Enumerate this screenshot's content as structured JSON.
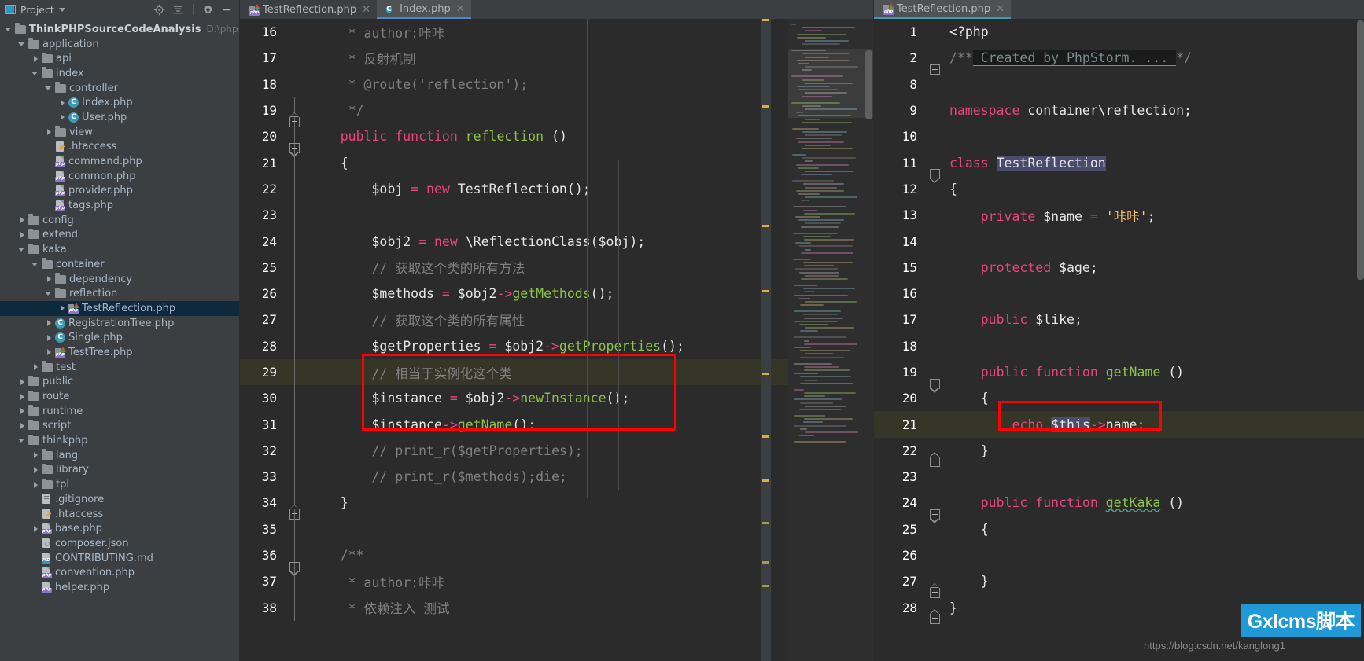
{
  "window": {
    "app": "PhpStorm"
  },
  "project_panel": {
    "title": "Project",
    "icons": [
      "locate-icon",
      "collapse-all-icon",
      "gear-icon",
      "minimize-icon"
    ],
    "tree": [
      {
        "label": "ThinkPHPSourceCodeAnalysis",
        "path": "D:\\phpstudy_pro\\W",
        "depth": 0,
        "arrow": "down",
        "icon": "folder",
        "bold": true
      },
      {
        "label": "application",
        "depth": 1,
        "arrow": "down",
        "icon": "folder"
      },
      {
        "label": "api",
        "depth": 2,
        "arrow": "right",
        "icon": "folder"
      },
      {
        "label": "index",
        "depth": 2,
        "arrow": "down",
        "icon": "folder"
      },
      {
        "label": "controller",
        "depth": 3,
        "arrow": "down",
        "icon": "folder"
      },
      {
        "label": "Index.php",
        "depth": 4,
        "arrow": "right",
        "icon": "php-class"
      },
      {
        "label": "User.php",
        "depth": 4,
        "arrow": "right",
        "icon": "php-class"
      },
      {
        "label": "view",
        "depth": 3,
        "arrow": "right",
        "icon": "folder"
      },
      {
        "label": ".htaccess",
        "depth": 3,
        "arrow": "none",
        "icon": "htaccess"
      },
      {
        "label": "command.php",
        "depth": 3,
        "arrow": "none",
        "icon": "php-file"
      },
      {
        "label": "common.php",
        "depth": 3,
        "arrow": "none",
        "icon": "php-file"
      },
      {
        "label": "provider.php",
        "depth": 3,
        "arrow": "none",
        "icon": "php-file"
      },
      {
        "label": "tags.php",
        "depth": 3,
        "arrow": "none",
        "icon": "php-file"
      },
      {
        "label": "config",
        "depth": 1,
        "arrow": "right",
        "icon": "folder"
      },
      {
        "label": "extend",
        "depth": 1,
        "arrow": "right",
        "icon": "folder"
      },
      {
        "label": "kaka",
        "depth": 1,
        "arrow": "down",
        "icon": "folder"
      },
      {
        "label": "container",
        "depth": 2,
        "arrow": "down",
        "icon": "folder"
      },
      {
        "label": "dependency",
        "depth": 3,
        "arrow": "right",
        "icon": "folder"
      },
      {
        "label": "reflection",
        "depth": 3,
        "arrow": "down",
        "icon": "folder"
      },
      {
        "label": "TestReflection.php",
        "depth": 4,
        "arrow": "right",
        "icon": "php-test",
        "selected": true
      },
      {
        "label": "RegistrationTree.php",
        "depth": 3,
        "arrow": "right",
        "icon": "php-class"
      },
      {
        "label": "Single.php",
        "depth": 3,
        "arrow": "right",
        "icon": "php-class"
      },
      {
        "label": "TestTree.php",
        "depth": 3,
        "arrow": "right",
        "icon": "php-test"
      },
      {
        "label": "test",
        "depth": 2,
        "arrow": "right",
        "icon": "folder"
      },
      {
        "label": "public",
        "depth": 1,
        "arrow": "right",
        "icon": "folder"
      },
      {
        "label": "route",
        "depth": 1,
        "arrow": "right",
        "icon": "folder"
      },
      {
        "label": "runtime",
        "depth": 1,
        "arrow": "right",
        "icon": "folder"
      },
      {
        "label": "script",
        "depth": 1,
        "arrow": "right",
        "icon": "folder"
      },
      {
        "label": "thinkphp",
        "depth": 1,
        "arrow": "down",
        "icon": "folder"
      },
      {
        "label": "lang",
        "depth": 2,
        "arrow": "right",
        "icon": "folder"
      },
      {
        "label": "library",
        "depth": 2,
        "arrow": "right",
        "icon": "folder"
      },
      {
        "label": "tpl",
        "depth": 2,
        "arrow": "right",
        "icon": "folder"
      },
      {
        "label": ".gitignore",
        "depth": 2,
        "arrow": "none",
        "icon": "gitignore"
      },
      {
        "label": ".htaccess",
        "depth": 2,
        "arrow": "none",
        "icon": "htaccess"
      },
      {
        "label": "base.php",
        "depth": 2,
        "arrow": "right",
        "icon": "php-file"
      },
      {
        "label": "composer.json",
        "depth": 2,
        "arrow": "none",
        "icon": "json"
      },
      {
        "label": "CONTRIBUTING.md",
        "depth": 2,
        "arrow": "none",
        "icon": "md-file"
      },
      {
        "label": "convention.php",
        "depth": 2,
        "arrow": "none",
        "icon": "php-file"
      },
      {
        "label": "helper.php",
        "depth": 2,
        "arrow": "none",
        "icon": "php-file"
      }
    ]
  },
  "left_tabs": [
    {
      "label": "TestReflection.php",
      "icon": "php-test",
      "active": false
    },
    {
      "label": "Index.php",
      "icon": "php-class",
      "active": true
    }
  ],
  "right_tabs": [
    {
      "label": "TestReflection.php",
      "icon": "php-test",
      "active": true
    }
  ],
  "browser_launcher": {
    "icons": [
      "chrome-icon",
      "edge-icon",
      "firefox-icon",
      "opera-icon",
      "safari-icon"
    ]
  },
  "left_editor": {
    "file": "Index.php",
    "first_line": 16,
    "highlighted_line": 29,
    "lines": [
      {
        "n": "16",
        "text": "     * author:咔咔"
      },
      {
        "n": "17",
        "text": "     * 反射机制"
      },
      {
        "n": "18",
        "text": "     * @route('reflection');"
      },
      {
        "n": "19",
        "text": "     */"
      },
      {
        "n": "20",
        "text": "    public function reflection ()"
      },
      {
        "n": "21",
        "text": "    {"
      },
      {
        "n": "22",
        "text": "        $obj = new TestReflection();"
      },
      {
        "n": "23",
        "text": ""
      },
      {
        "n": "24",
        "text": "        $obj2 = new \\ReflectionClass($obj);"
      },
      {
        "n": "25",
        "text": "        // 获取这个类的所有方法"
      },
      {
        "n": "26",
        "text": "        $methods = $obj2->getMethods();"
      },
      {
        "n": "27",
        "text": "        // 获取这个类的所有属性"
      },
      {
        "n": "28",
        "text": "        $getProperties = $obj2->getProperties();"
      },
      {
        "n": "29",
        "text": "        // 相当于实例化这个类"
      },
      {
        "n": "30",
        "text": "        $instance = $obj2->newInstance();"
      },
      {
        "n": "31",
        "text": "        $instance->getName();"
      },
      {
        "n": "32",
        "text": "        // print_r($getProperties);"
      },
      {
        "n": "33",
        "text": "        // print_r($methods);die;"
      },
      {
        "n": "34",
        "text": "    }"
      },
      {
        "n": "35",
        "text": ""
      },
      {
        "n": "36",
        "text": "    /**"
      },
      {
        "n": "37",
        "text": "     * author:咔咔"
      },
      {
        "n": "38",
        "text": "     * 依赖注入 测试"
      }
    ]
  },
  "right_editor": {
    "file": "TestReflection.php",
    "highlighted_line": 21,
    "fold_placeholder": "Created by PhpStorm. ...",
    "lines": [
      {
        "n": "1",
        "text": "<?php"
      },
      {
        "n": "2",
        "text": "/** Created by PhpStorm. ...*/"
      },
      {
        "n": "8",
        "text": ""
      },
      {
        "n": "9",
        "text": "namespace container\\reflection;"
      },
      {
        "n": "10",
        "text": ""
      },
      {
        "n": "11",
        "text": "class TestReflection"
      },
      {
        "n": "12",
        "text": "{"
      },
      {
        "n": "13",
        "text": "    private $name = '咔咔';"
      },
      {
        "n": "14",
        "text": ""
      },
      {
        "n": "15",
        "text": "    protected $age;"
      },
      {
        "n": "16",
        "text": ""
      },
      {
        "n": "17",
        "text": "    public $like;"
      },
      {
        "n": "18",
        "text": ""
      },
      {
        "n": "19",
        "text": "    public function getName ()"
      },
      {
        "n": "20",
        "text": "    {"
      },
      {
        "n": "21",
        "text": "        echo $this->name;"
      },
      {
        "n": "22",
        "text": "    }"
      },
      {
        "n": "23",
        "text": ""
      },
      {
        "n": "24",
        "text": "    public function getKaka ()"
      },
      {
        "n": "25",
        "text": "    {"
      },
      {
        "n": "26",
        "text": ""
      },
      {
        "n": "27",
        "text": "    }"
      },
      {
        "n": "28",
        "text": "}"
      }
    ]
  },
  "annotations": {
    "left_box_label": "red-highlight-box-left",
    "right_box_label": "red-highlight-box-right",
    "color": "#ff0000"
  },
  "watermark": {
    "url": "https://blog.csdn.net/kanglong1",
    "logo": "Gxlcms脚本"
  }
}
